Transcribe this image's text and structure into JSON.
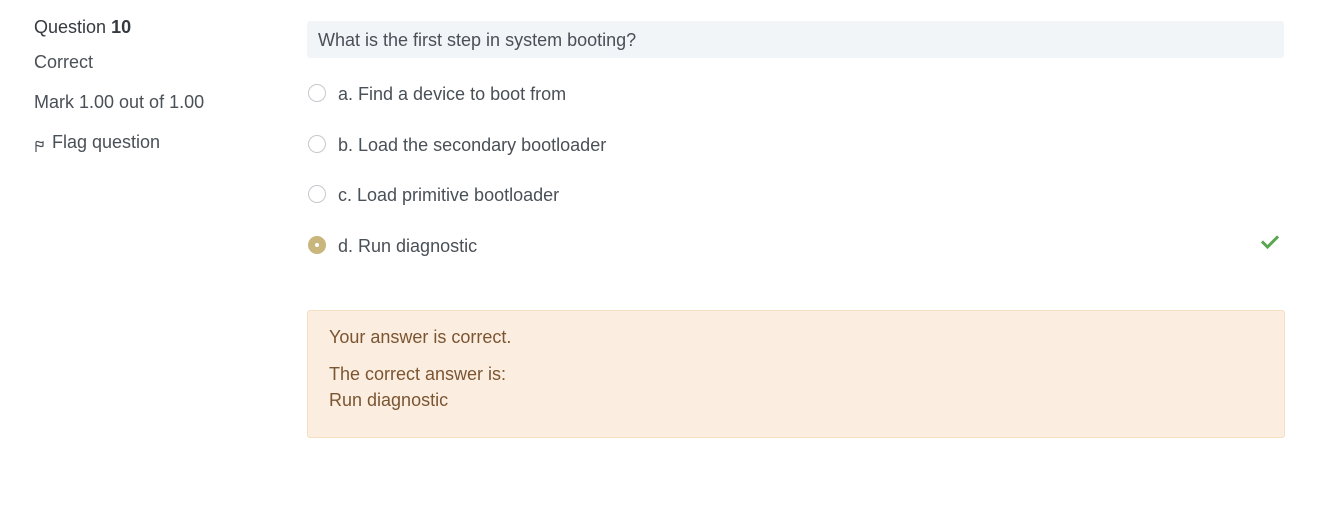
{
  "info": {
    "question_label": "Question",
    "question_number": "10",
    "state": "Correct",
    "grade": "Mark 1.00 out of 1.00",
    "flag_label": "Flag question"
  },
  "question": {
    "text": "What is the first step in system booting?",
    "options": [
      {
        "label": "a. Find a device to boot from",
        "selected": false
      },
      {
        "label": "b. Load the secondary bootloader",
        "selected": false
      },
      {
        "label": "c. Load primitive bootloader",
        "selected": false
      },
      {
        "label": "d. Run diagnostic",
        "selected": true,
        "correct": true
      }
    ]
  },
  "feedback": {
    "specific": "Your answer is correct.",
    "right_answer_label": "The correct answer is:",
    "right_answer_value": "Run diagnostic"
  },
  "colors": {
    "selected_radio": "#c8b67c",
    "check_mark": "#5aa651",
    "feedback_bg": "#fbeee0",
    "feedback_text": "#7b5532",
    "question_bg": "#f2f5f8"
  },
  "icons": {
    "flag": "flag-icon",
    "correct": "check-icon"
  }
}
